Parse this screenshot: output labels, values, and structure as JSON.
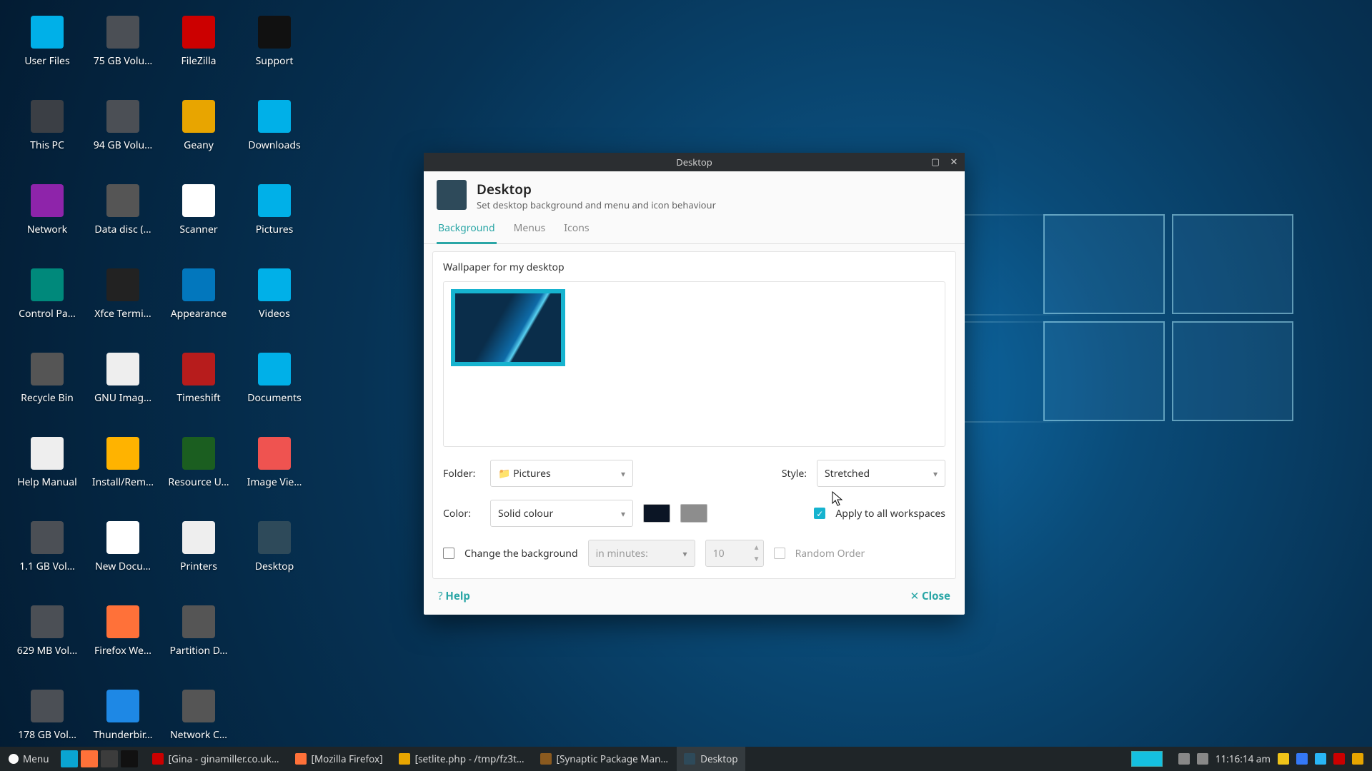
{
  "desktop_icons": [
    {
      "label": "User Files",
      "glyph": "g-folder"
    },
    {
      "label": "75 GB Volu…",
      "glyph": "g-drive"
    },
    {
      "label": "FileZilla",
      "glyph": "g-fz"
    },
    {
      "label": "Support",
      "glyph": "g-support"
    },
    {
      "label": "This PC",
      "glyph": "g-pc"
    },
    {
      "label": "94 GB Volu…",
      "glyph": "g-drive"
    },
    {
      "label": "Geany",
      "glyph": "g-geany"
    },
    {
      "label": "Downloads",
      "glyph": "g-folder"
    },
    {
      "label": "Network",
      "glyph": "g-net"
    },
    {
      "label": "Data disc (…",
      "glyph": "g-disc"
    },
    {
      "label": "Scanner",
      "glyph": "g-scan"
    },
    {
      "label": "Pictures",
      "glyph": "g-folder"
    },
    {
      "label": "Control Pa…",
      "glyph": "g-cpanel"
    },
    {
      "label": "Xfce Termi…",
      "glyph": "g-term"
    },
    {
      "label": "Appearance",
      "glyph": "g-appear"
    },
    {
      "label": "Videos",
      "glyph": "g-folder"
    },
    {
      "label": "Recycle Bin",
      "glyph": "g-trash"
    },
    {
      "label": "GNU Imag…",
      "glyph": "g-gimp"
    },
    {
      "label": "Timeshift",
      "glyph": "g-time"
    },
    {
      "label": "Documents",
      "glyph": "g-folder"
    },
    {
      "label": "Help Manual",
      "glyph": "g-help"
    },
    {
      "label": "Install/Rem…",
      "glyph": "g-install"
    },
    {
      "label": "Resource U…",
      "glyph": "g-res"
    },
    {
      "label": "Image Vie…",
      "glyph": "g-imgv"
    },
    {
      "label": "1.1 GB Vol…",
      "glyph": "g-drive"
    },
    {
      "label": "New Docu…",
      "glyph": "g-doc"
    },
    {
      "label": "Printers",
      "glyph": "g-print"
    },
    {
      "label": "Desktop",
      "glyph": "g-desk"
    },
    {
      "label": "629 MB Vol…",
      "glyph": "g-drive"
    },
    {
      "label": "Firefox We…",
      "glyph": "g-ff"
    },
    {
      "label": "Partition D…",
      "glyph": "g-part"
    },
    {
      "label": "",
      "glyph": ""
    },
    {
      "label": "178 GB Vol…",
      "glyph": "g-drive"
    },
    {
      "label": "Thunderbir…",
      "glyph": "g-tb"
    },
    {
      "label": "Network C…",
      "glyph": "g-netc"
    }
  ],
  "dialog": {
    "window_title": "Desktop",
    "heading": "Desktop",
    "subheading": "Set desktop background and menu and icon behaviour",
    "tabs": [
      "Background",
      "Menus",
      "Icons"
    ],
    "section": "Wallpaper for my desktop",
    "folder_label": "Folder:",
    "folder_value": "Pictures",
    "style_label": "Style:",
    "style_value": "Stretched",
    "color_label": "Color:",
    "color_value": "Solid colour",
    "apply_label": "Apply to all workspaces",
    "change_label": "Change the background",
    "interval_placeholder": "in minutes:",
    "interval_value": "10",
    "random_label": "Random Order",
    "help": "Help",
    "close": "Close"
  },
  "taskbar": {
    "menu": "Menu",
    "tasks": [
      {
        "label": "[Gina - ginamiller.co.uk…",
        "color": "#c00"
      },
      {
        "label": "[Mozilla Firefox]",
        "color": "#ff7139"
      },
      {
        "label": "[setlite.php - /tmp/fz3t…",
        "color": "#e8a500"
      },
      {
        "label": "[Synaptic Package Man…",
        "color": "#8a5a1f"
      },
      {
        "label": "Desktop",
        "color": "#2e4a5a",
        "active": true
      }
    ],
    "clock": "11:16:14 am"
  }
}
